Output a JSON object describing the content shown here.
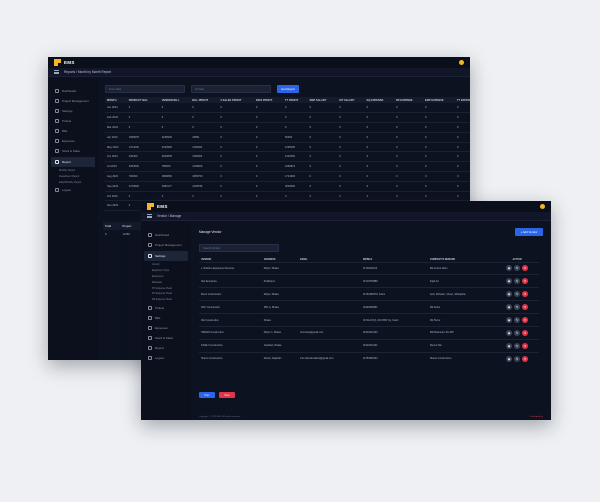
{
  "app": {
    "logo_text": "EMS"
  },
  "back_window": {
    "breadcrumb": "Reports / Month by Month Report",
    "sidebar": [
      {
        "label": "Dashboard",
        "icon": "dashboard-icon"
      },
      {
        "label": "Project Management",
        "icon": "folder-icon"
      },
      {
        "label": "Settings",
        "icon": "gear-icon"
      },
      {
        "label": "Tickets",
        "icon": "ticket-icon"
      },
      {
        "label": "Bills",
        "icon": "file-icon"
      },
      {
        "label": "Expenses",
        "icon": "wallet-icon"
      },
      {
        "label": "Stock & Sales",
        "icon": "box-icon"
      }
    ],
    "sidebar_active": {
      "label": "Report",
      "icon": "chart-icon"
    },
    "sidebar_sub": [
      "Monthly Report",
      "Department Report",
      "Daily/Monthly Report"
    ],
    "sidebar_bottom": {
      "label": "Logout",
      "icon": "logout-icon"
    },
    "filters": {
      "from_placeholder": "From Date",
      "to_placeholder": "To Date",
      "button": "Get Report"
    },
    "columns": [
      "MONTH",
      "PRODUCT BILL",
      "VENDOR BILL",
      "BILL PROFIT",
      "2 SALES PROFIT",
      "DIGS PROFIT",
      "TT PROFIT",
      "EMP SALARY",
      "HIT SALARY",
      "EQ EXPENSE",
      "PR EXPENSE",
      "EMP EXPENSE",
      "TT EXPENSE",
      "NET PROFIT"
    ],
    "rows": [
      [
        "Jan 2023",
        "0",
        "0",
        "0",
        "0",
        "0",
        "0",
        "0",
        "0",
        "0",
        "0",
        "0",
        "0",
        "0"
      ],
      [
        "Feb 2023",
        "0",
        "0",
        "0",
        "0",
        "0",
        "0",
        "0",
        "0",
        "0",
        "0",
        "0",
        "0",
        "0"
      ],
      [
        "Mar 2023",
        "0",
        "0",
        "0",
        "0",
        "0",
        "0",
        "0",
        "0",
        "0",
        "0",
        "0",
        "0",
        "0"
      ],
      [
        "Apr 2023",
        "1665678",
        "2189930",
        "20891",
        "0",
        "0",
        "50000",
        "0",
        "0",
        "0",
        "0",
        "0",
        "0",
        "50000"
      ],
      [
        "May 2023",
        "1474200",
        "3340990",
        "1155200",
        "0",
        "0",
        "1295000",
        "0",
        "0",
        "0",
        "0",
        "0",
        "0",
        "1295000"
      ],
      [
        "Jun 2023",
        "346400",
        "3940805",
        "1166600",
        "0",
        "0",
        "1222500",
        "0",
        "0",
        "0",
        "0",
        "0",
        "0",
        "1222500"
      ],
      [
        "Jul 2023",
        "2063500",
        "786660",
        "1209500",
        "0",
        "0",
        "4460872",
        "0",
        "0",
        "0",
        "0",
        "0",
        "0",
        "4460872"
      ],
      [
        "Aug 2023",
        "700000",
        "1860800",
        "3365700",
        "0",
        "0",
        "1713000",
        "0",
        "0",
        "0",
        "0",
        "0",
        "0",
        "1713000"
      ],
      [
        "Sep 2023",
        "2479500",
        "3380177",
        "2166536",
        "0",
        "0",
        "3000000",
        "0",
        "0",
        "0",
        "0",
        "0",
        "0",
        "3000000"
      ],
      [
        "Oct 2023",
        "0",
        "0",
        "0",
        "0",
        "0",
        "0",
        "0",
        "0",
        "0",
        "0",
        "0",
        "0",
        "0"
      ],
      [
        "Nov 2023",
        "0",
        "0",
        "0",
        "0",
        "0",
        "0",
        "0",
        "0",
        "0",
        "0",
        "0",
        "0",
        "0"
      ]
    ],
    "summary_columns": [
      "Total",
      "Project"
    ],
    "summary_row": [
      "0",
      "12480"
    ]
  },
  "front_window": {
    "breadcrumb": "Vendor / Manage",
    "page_title": "Manage Vendor",
    "new_button": "+ Add Vendor",
    "search_placeholder": "Search Vendor",
    "sidebar": [
      {
        "label": "Dashboard",
        "icon": "dashboard-icon"
      },
      {
        "label": "Project Management",
        "icon": "folder-icon"
      }
    ],
    "sidebar_active": {
      "label": "Settings",
      "icon": "gear-icon"
    },
    "sidebar_sub": [
      "Vendor",
      "Equipment Type",
      "Equipment",
      "Materials",
      "PO Expense Head",
      "PO Expense Head",
      "PR Expense Head"
    ],
    "sidebar_bottom": [
      {
        "label": "Tickets",
        "icon": "ticket-icon"
      },
      {
        "label": "Bills",
        "icon": "file-icon"
      },
      {
        "label": "Expenses",
        "icon": "wallet-icon"
      },
      {
        "label": "Stock & Sales",
        "icon": "box-icon"
      },
      {
        "label": "Report",
        "icon": "chart-icon"
      },
      {
        "label": "Logout",
        "icon": "logout-icon"
      }
    ],
    "columns": [
      "VENDOR",
      "ADDRESS",
      "EMAIL",
      "MOBILE",
      "COMPANY'S REMARK",
      "ACTION"
    ],
    "rows": [
      [
        "L. Builders Equipment Services",
        "Mirpur, Dhaka",
        "",
        "01700011123",
        "Md Aminul Islam"
      ],
      [
        "Star Enterprise",
        "Khalishpur",
        "",
        "01710578888",
        "Kajol Ali"
      ],
      [
        "Metro Construction",
        "Mirpur, Dhaka",
        "",
        "01760360678, Karim",
        "Anik, Mohasin, Shuvo, Shahjahan"
      ],
      [
        "RFC Construction",
        "38/1 A, Dhaka",
        "",
        "01920839891",
        "Md Sohel"
      ],
      [
        "FIE Construction",
        "Dhaka",
        "",
        "01711217(2), 016 0567 (s), Karim",
        "Md Huzur"
      ],
      [
        "HRMAN Construction",
        "Mirpur 1, Dhaka",
        "hrcontact@gmail.com",
        "01916344102",
        "MD Rashedul, SLLPM"
      ],
      [
        "SAIDLI Construction",
        "Jatrabari, Dhaka",
        "",
        "01916344101",
        "Munna Tak"
      ],
      [
        "Shams Construction",
        "Moulvi, Rajshahi",
        "info.shamsbuilders@gmail.com",
        "01750965433",
        "Shams Construction"
      ]
    ],
    "prev_button": "Prev",
    "next_button": "Next",
    "footer_left": "Copyright © 2023 EMS. All rights reserved.",
    "footer_right": "Developed by"
  },
  "colors": {
    "accent": "#2c64e8",
    "danger": "#e0344a",
    "brand": "#f2b728",
    "bg": "#0d1220"
  }
}
